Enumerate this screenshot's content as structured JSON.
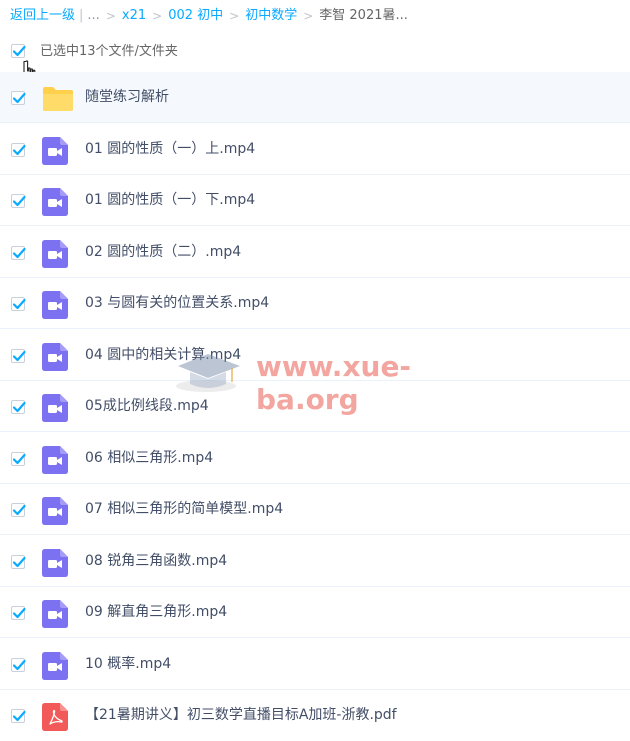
{
  "breadcrumb": {
    "back": "返回上一级",
    "ellipsis": "...",
    "items": [
      "x21",
      "002 初中",
      "初中数学"
    ],
    "current": "李智 2021暑..."
  },
  "selection": {
    "label": "已选中13个文件/文件夹",
    "checked": true
  },
  "files": [
    {
      "name": "随堂练习解析",
      "type": "folder-icon"
    },
    {
      "name": "01 圆的性质（一）上.mp4",
      "type": "video-icon"
    },
    {
      "name": "01 圆的性质（一）下.mp4",
      "type": "video-icon"
    },
    {
      "name": "02 圆的性质（二）.mp4",
      "type": "video-icon"
    },
    {
      "name": "03 与圆有关的位置关系.mp4",
      "type": "video-icon"
    },
    {
      "name": "04 圆中的相关计算.mp4",
      "type": "video-icon"
    },
    {
      "name": "05成比例线段.mp4",
      "type": "video-icon"
    },
    {
      "name": "06 相似三角形.mp4",
      "type": "video-icon"
    },
    {
      "name": "07 相似三角形的简单模型.mp4",
      "type": "video-icon"
    },
    {
      "name": "08 锐角三角函数.mp4",
      "type": "video-icon"
    },
    {
      "name": "09 解直角三角形.mp4",
      "type": "video-icon"
    },
    {
      "name": "10 概率.mp4",
      "type": "video-icon"
    },
    {
      "name": "【21暑期讲义】初三数学直播目标A加班-浙教.pdf",
      "type": "pdf-icon"
    }
  ],
  "watermark": {
    "text": "www.xue-ba.org"
  },
  "colors": {
    "link": "#09aaff",
    "checkbox": "#09aaff",
    "folder": "#ffd04b",
    "video": "#7c71f1",
    "pdf": "#f25a5a",
    "row_border": "#e9f1fa"
  }
}
